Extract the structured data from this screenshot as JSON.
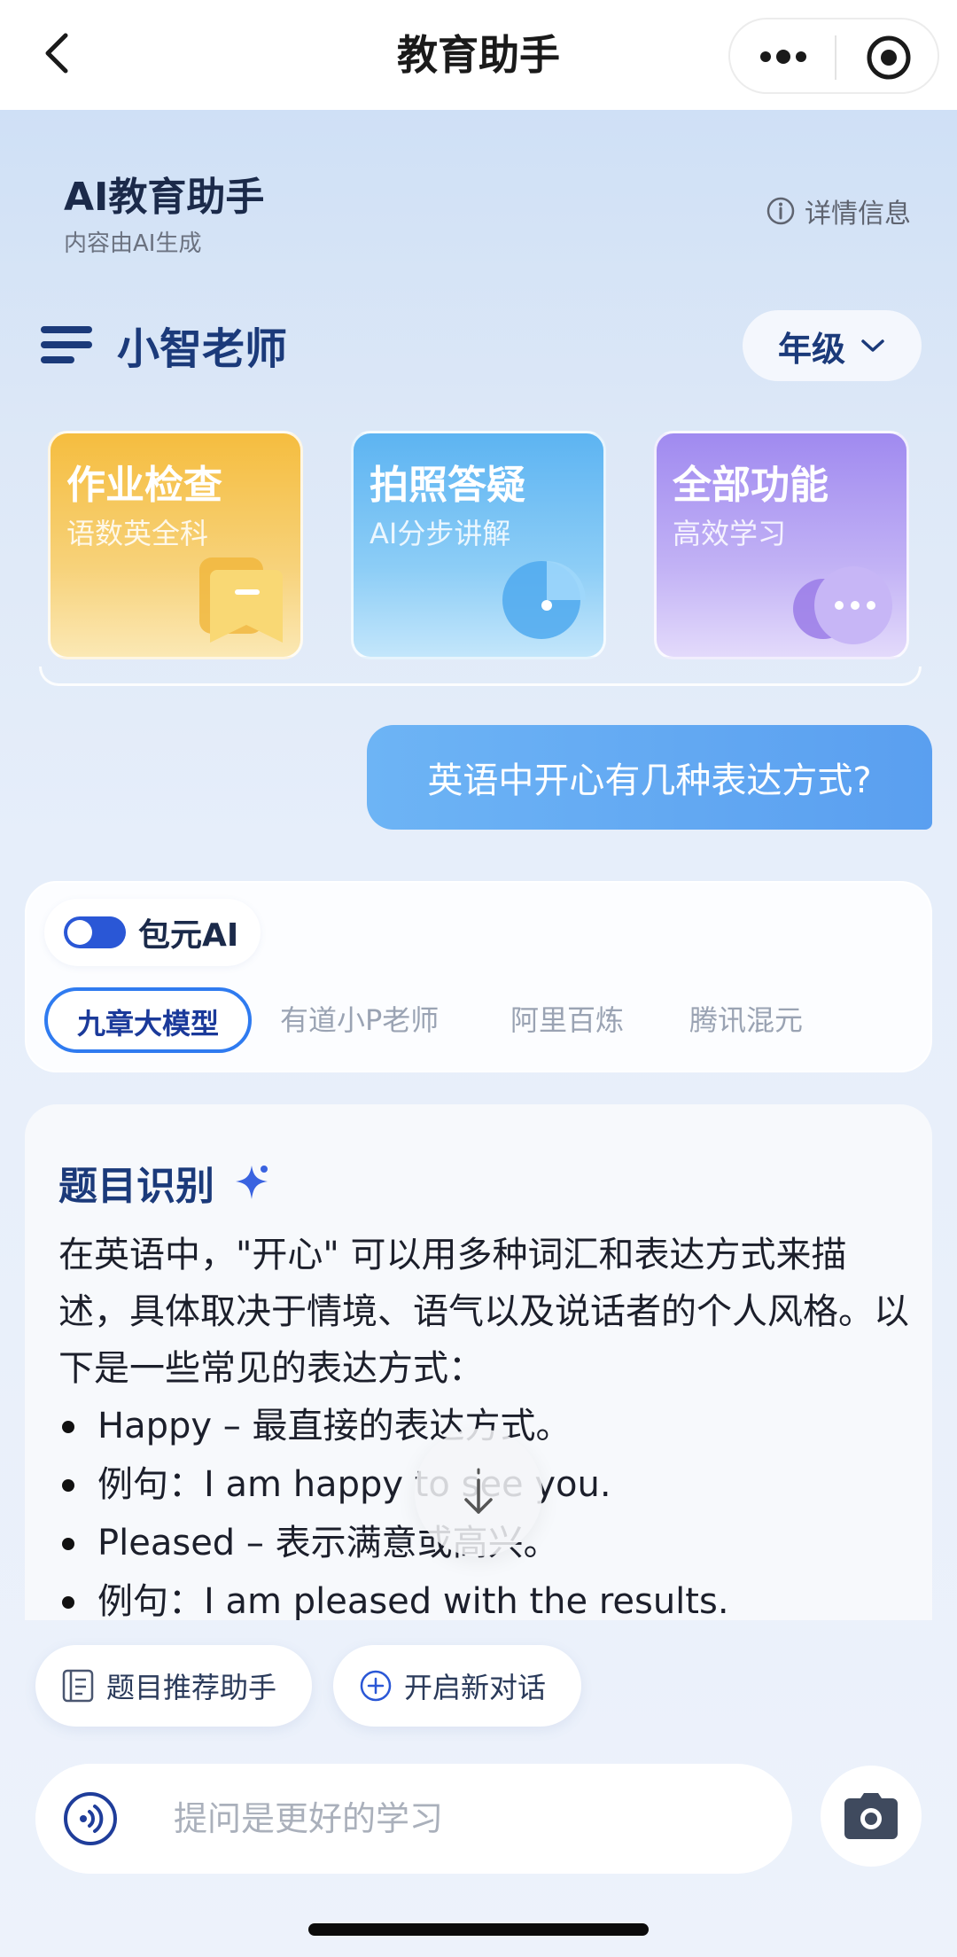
{
  "nav": {
    "title": "教育助手"
  },
  "header": {
    "app_name": "AI教育助手",
    "app_sub": "内容由AI生成",
    "detail_link": "详情信息"
  },
  "teacher": {
    "name": "小智老师",
    "grade_label": "年级"
  },
  "cards": [
    {
      "title": "作业检查",
      "subtitle": "语数英全科",
      "color": "#f5bd3f"
    },
    {
      "title": "拍照答疑",
      "subtitle": "AI分步讲解",
      "color": "#5db4f2"
    },
    {
      "title": "全部功能",
      "subtitle": "高效学习",
      "color": "#a08af0"
    }
  ],
  "user_message": "英语中开心有几种表达方式?",
  "model_panel": {
    "toggle_label": "包元AI",
    "tabs": [
      "九章大模型",
      "有道小P老师",
      "阿里百炼",
      "腾讯混元"
    ],
    "active_tab": "九章大模型"
  },
  "answer": {
    "title": "题目识别",
    "body": "在英语中，\"开心\" 可以用多种词汇和表达方式来描述，具体取决于情境、语气以及说话者的个人风格。以下是一些常见的表达方式：",
    "bullets": [
      "Happy – 最直接的表达方式。",
      "例句：I am happy to see you.",
      "Pleased – 表示满意或高兴。",
      "例句：I am pleased with the results."
    ]
  },
  "chips": {
    "recommend": "题目推荐助手",
    "new_chat": "开启新对话"
  },
  "input": {
    "placeholder": "提问是更好的学习"
  },
  "colors": {
    "accent": "#2a57d6",
    "user_bubble": "#5a9ff0",
    "title_blue": "#1b3a7a"
  }
}
